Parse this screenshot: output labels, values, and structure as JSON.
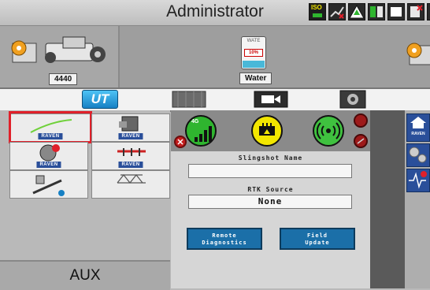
{
  "header": {
    "title": "Administrator",
    "iso_label": "ISO"
  },
  "machine": {
    "model_label": "4440"
  },
  "product": {
    "label": "Water",
    "tank_top": "WATE",
    "tank_percent": "10%"
  },
  "tabs": [
    {
      "label": "UT",
      "name": "tab-ut",
      "active": true
    },
    {
      "label": "",
      "name": "tab-map",
      "active": false
    },
    {
      "label": "",
      "name": "tab-camera",
      "active": false
    },
    {
      "label": "",
      "name": "tab-settings",
      "active": false
    }
  ],
  "apps": [
    {
      "name": "app-raven-guidance",
      "brand": "RAVEN",
      "selected": true
    },
    {
      "name": "app-raven-rate",
      "brand": "RAVEN",
      "selected": false
    },
    {
      "name": "app-raven-diagnostics",
      "brand": "RAVEN",
      "selected": false
    },
    {
      "name": "app-raven-boom",
      "brand": "RAVEN",
      "selected": false
    },
    {
      "name": "app-raven-implement",
      "brand": "",
      "selected": false
    },
    {
      "name": "app-raven-toolbar",
      "brand": "",
      "selected": false
    }
  ],
  "aux": {
    "label": "AUX"
  },
  "slingshot": {
    "name_label": "Slingshot Name",
    "name_value": "",
    "rtk_label": "RTK Source",
    "rtk_value": "None",
    "remote_button": "Remote\nDiagnostics",
    "remote_line1": "Remote",
    "remote_line2": "Diagnostics",
    "field_line1": "Field",
    "field_line2": "Update",
    "cell_badge": "4G"
  },
  "right_panel": {
    "brand": "RAVEN"
  },
  "colors": {
    "selected_outline": "#e0202a",
    "cell_green": "#2fb52f",
    "ethernet_yellow": "#f2e600",
    "wifi_green": "#3fc13f",
    "raven_blue": "#2a4f9a",
    "button_blue": "#1b6fa8",
    "error_red": "#c41d1d"
  }
}
